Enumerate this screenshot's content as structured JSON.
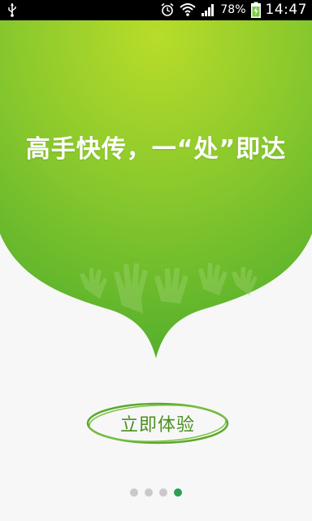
{
  "status_bar": {
    "battery_percent": "78%",
    "time": "14:47",
    "icons": [
      "usb-icon",
      "alarm-icon",
      "wifi-icon",
      "signal-icon",
      "battery-icon"
    ]
  },
  "hero": {
    "headline": "高手快传，一“处”即达",
    "colors": {
      "green_light": "#b6d92a",
      "green_dark": "#5fb82c"
    }
  },
  "cta": {
    "label": "立即体验",
    "color": "#4a8f1f"
  },
  "pager": {
    "count": 4,
    "active_index": 3,
    "active_color": "#2e9d55",
    "inactive_color": "#c9c9c9"
  }
}
